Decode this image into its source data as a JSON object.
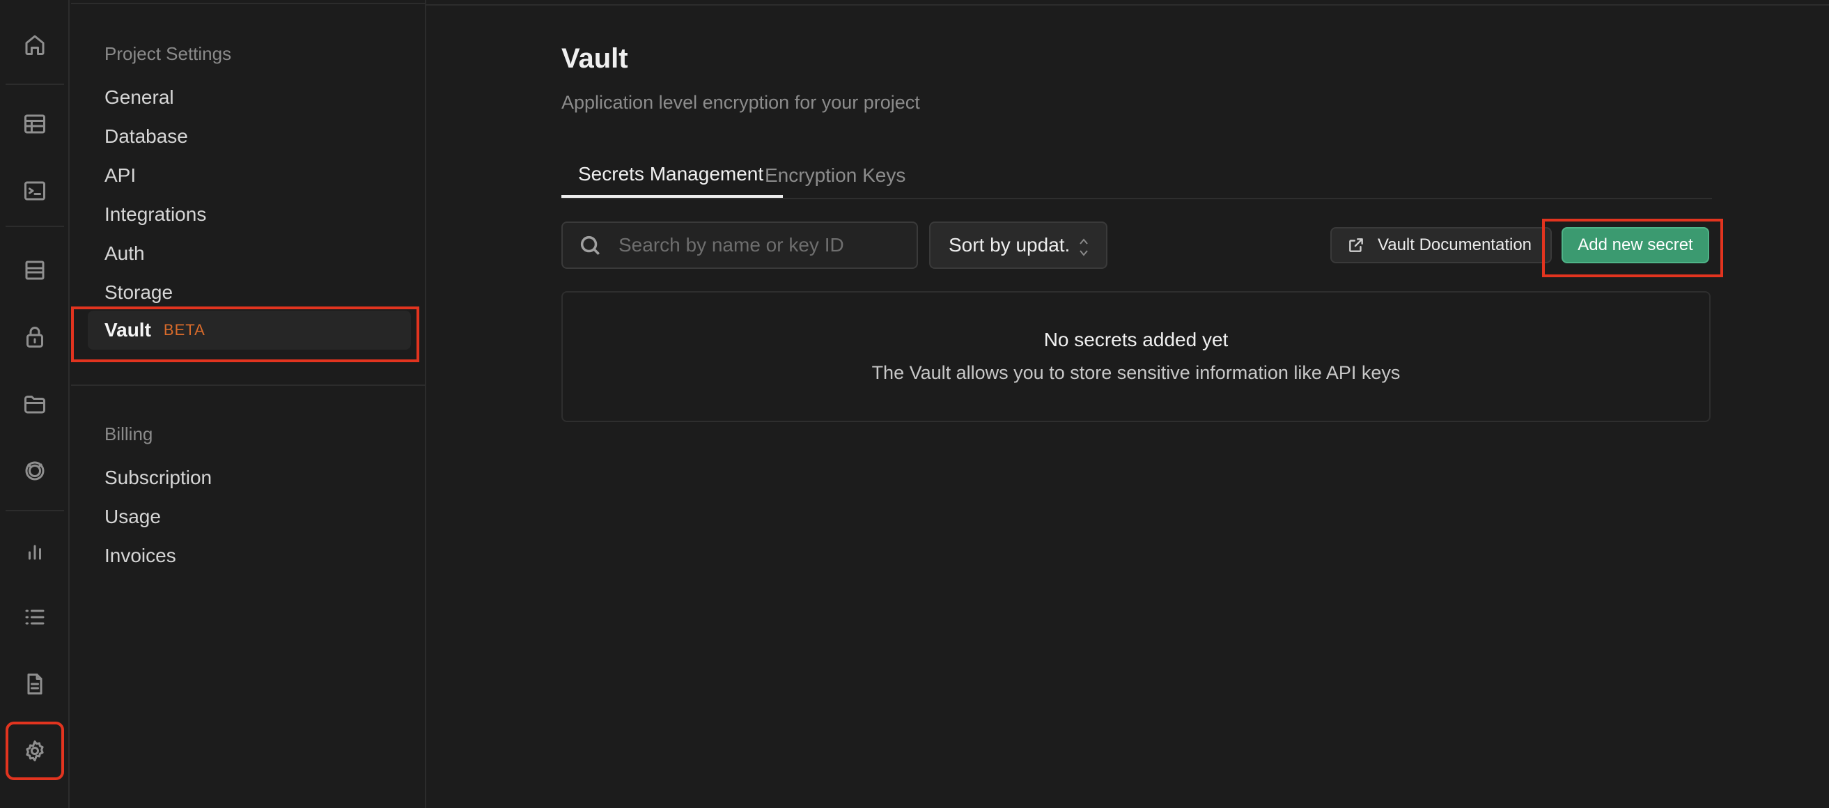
{
  "settings_sidebar": {
    "project_settings_title": "Project Settings",
    "project_items": [
      "General",
      "Database",
      "API",
      "Integrations",
      "Auth",
      "Storage"
    ],
    "vault": {
      "label": "Vault",
      "badge": "BETA"
    },
    "billing_title": "Billing",
    "billing_items": [
      "Subscription",
      "Usage",
      "Invoices"
    ]
  },
  "icon_rail": [
    "home-icon",
    "table-editor-icon",
    "sql-editor-icon",
    "database-icon",
    "authentication-icon",
    "storage-icon",
    "realtime-icon",
    "reports-icon",
    "logs-icon",
    "api-docs-icon",
    "settings-icon"
  ],
  "main": {
    "title": "Vault",
    "subtitle": "Application level encryption for your project",
    "tabs": [
      {
        "label": "Secrets Management",
        "active": true
      },
      {
        "label": "Encryption Keys",
        "active": false
      }
    ],
    "search": {
      "placeholder": "Search by name or key ID",
      "value": ""
    },
    "sort": {
      "label": "Sort by updat."
    },
    "docs_button": "Vault Documentation",
    "add_button": "Add new secret",
    "empty_state": {
      "title": "No secrets added yet",
      "description": "The Vault allows you to store sensitive information like API keys"
    }
  },
  "colors": {
    "background": "#1c1c1c",
    "accent_green": "#3b9a70",
    "beta_orange": "#d96b2b",
    "highlight_red": "#e2341f"
  }
}
